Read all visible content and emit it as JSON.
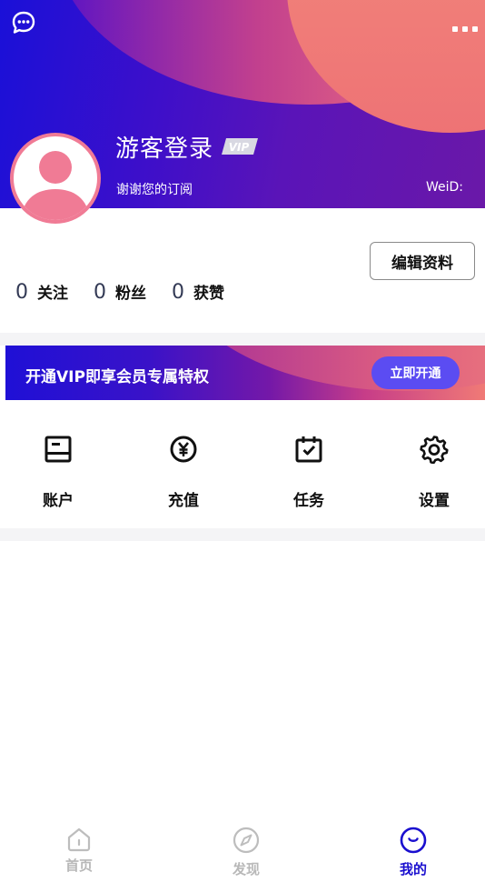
{
  "header": {
    "username": "游客登录",
    "vip_badge": "VIP",
    "subtitle": "谢谢您的订阅",
    "weid_label": "WeiD:",
    "chat_icon": "chat-bubble-icon",
    "more_icon": "more-dots-icon"
  },
  "profile": {
    "edit_button": "编辑资料",
    "stats": [
      {
        "count": "0",
        "label": "关注"
      },
      {
        "count": "0",
        "label": "粉丝"
      },
      {
        "count": "0",
        "label": "获赞"
      }
    ]
  },
  "vip_banner": {
    "text": "开通VIP即享会员专属特权",
    "button": "立即开通"
  },
  "menu": [
    {
      "label": "账户",
      "icon": "account-card-icon"
    },
    {
      "label": "充值",
      "icon": "yen-coin-icon"
    },
    {
      "label": "任务",
      "icon": "calendar-check-icon"
    },
    {
      "label": "设置",
      "icon": "gear-icon"
    }
  ],
  "tabs": [
    {
      "label": "首页",
      "icon": "home-icon",
      "active": false
    },
    {
      "label": "发现",
      "icon": "compass-icon",
      "active": false
    },
    {
      "label": "我的",
      "icon": "profile-face-icon",
      "active": true
    }
  ],
  "colors": {
    "accent": "#1a0fcf",
    "avatar_pink": "#f07b95",
    "vip_button": "#5b4cf2"
  }
}
